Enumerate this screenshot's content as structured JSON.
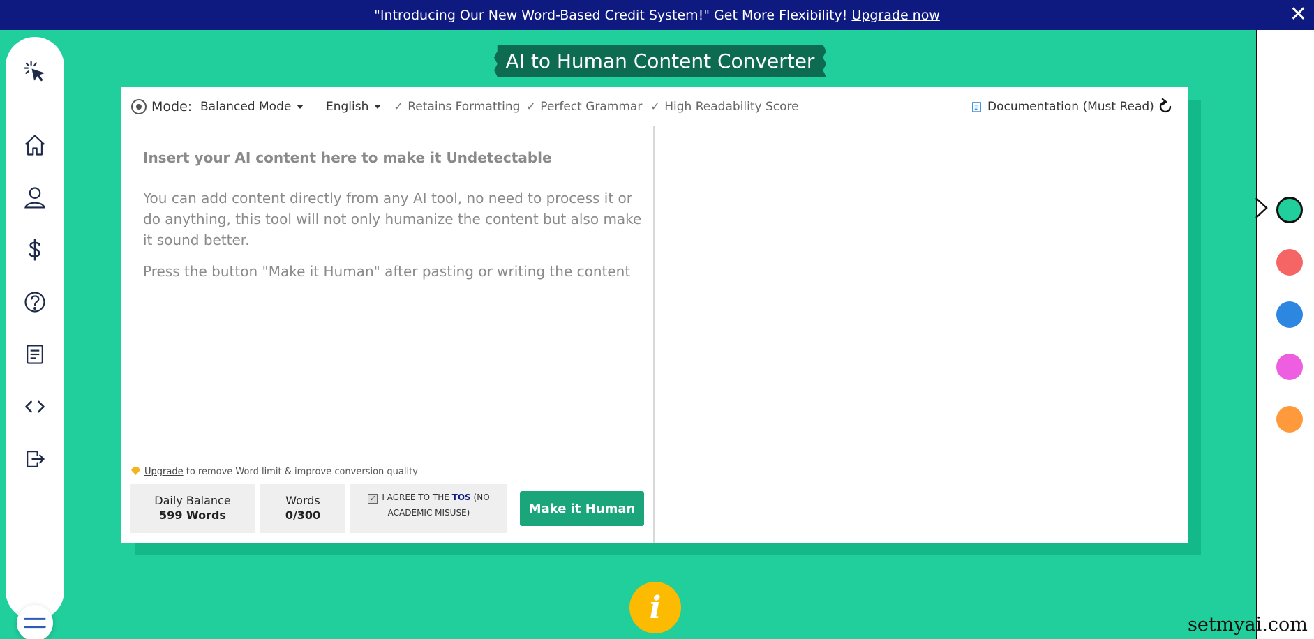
{
  "banner": {
    "text": "\"Introducing Our New Word-Based Credit System!\" Get More Flexibility!",
    "link": "Upgrade now",
    "close": "✕"
  },
  "title": "AI to Human Content Converter",
  "toolbar": {
    "mode_label": "Mode:",
    "mode_value": "Balanced Mode",
    "language": "English",
    "features": [
      "Retains Formatting",
      "Perfect Grammar",
      "High Readability Score"
    ],
    "documentation": "Documentation (Must Read)"
  },
  "editor": {
    "placeholder_title": "Insert your AI content here to make it Undetectable",
    "placeholder_p1": "You can add content directly from any AI tool, no need to process it or do anything, this tool will not only humanize the content but also make it sound better.",
    "placeholder_p2": "Press the button \"Make it Human\" after pasting or writing the content"
  },
  "footer": {
    "upgrade_link": "Upgrade",
    "upgrade_text": "to remove Word limit & improve conversion quality",
    "daily_balance_label": "Daily Balance",
    "daily_balance_value": "599 Words",
    "words_label": "Words",
    "words_value": "0/300",
    "tos_pre": "I AGREE TO THE",
    "tos_link": "TOS",
    "tos_post": "(NO ACADEMIC MISUSE)",
    "tos_checked": true,
    "button": "Make it Human"
  },
  "info_icon": "i",
  "swatches": [
    "#20cf9c",
    "#f56565",
    "#2d86e0",
    "#ee5ee0",
    "#ff9a3c"
  ],
  "watermark": "setmyai.com",
  "colors": {
    "banner": "#0f1a80",
    "brand_green": "#20cf9c",
    "title_bg": "#0c6b50",
    "button": "#1aa67a",
    "info": "#fcbb00"
  }
}
